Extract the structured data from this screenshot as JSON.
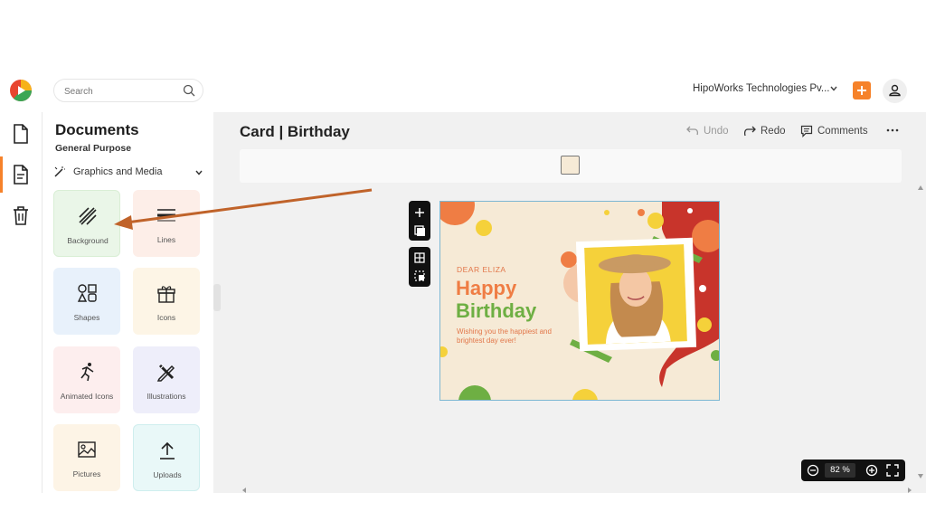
{
  "search": {
    "placeholder": "Search"
  },
  "header": {
    "org_name": "HipoWorks Technologies Pv..."
  },
  "panel": {
    "title": "Documents",
    "subtitle": "General Purpose",
    "category": "Graphics and Media",
    "tiles": [
      {
        "label": "Background",
        "icon": "background-hatch-icon",
        "color": "#eaf6e8"
      },
      {
        "label": "Lines",
        "icon": "lines-icon",
        "color": "#fdeee8"
      },
      {
        "label": "Shapes",
        "icon": "shapes-icon",
        "color": "#e8f1fb"
      },
      {
        "label": "Icons",
        "icon": "gift-icon",
        "color": "#fdf5e6"
      },
      {
        "label": "Animated Icons",
        "icon": "running-figure-icon",
        "color": "#fdeeee"
      },
      {
        "label": "Illustrations",
        "icon": "pencil-ruler-icon",
        "color": "#eeeefa"
      },
      {
        "label": "Pictures",
        "icon": "image-icon",
        "color": "#fdf4e6"
      },
      {
        "label": "Uploads",
        "icon": "upload-icon",
        "color": "#e9f8f8"
      }
    ]
  },
  "editor": {
    "doc_title": "Card | Birthday",
    "undo": "Undo",
    "redo": "Redo",
    "comments": "Comments",
    "background_swatch_color": "#f6ead6"
  },
  "card": {
    "dear": "DEAR ELIZA",
    "happy": "Happy",
    "birthday": "Birthday",
    "wish": "Wishing you the happiest and brightest day ever!"
  },
  "zoom": {
    "value": "82  %"
  },
  "colors": {
    "accent": "#f6822a",
    "annotation_arrow": "#c0632a"
  }
}
